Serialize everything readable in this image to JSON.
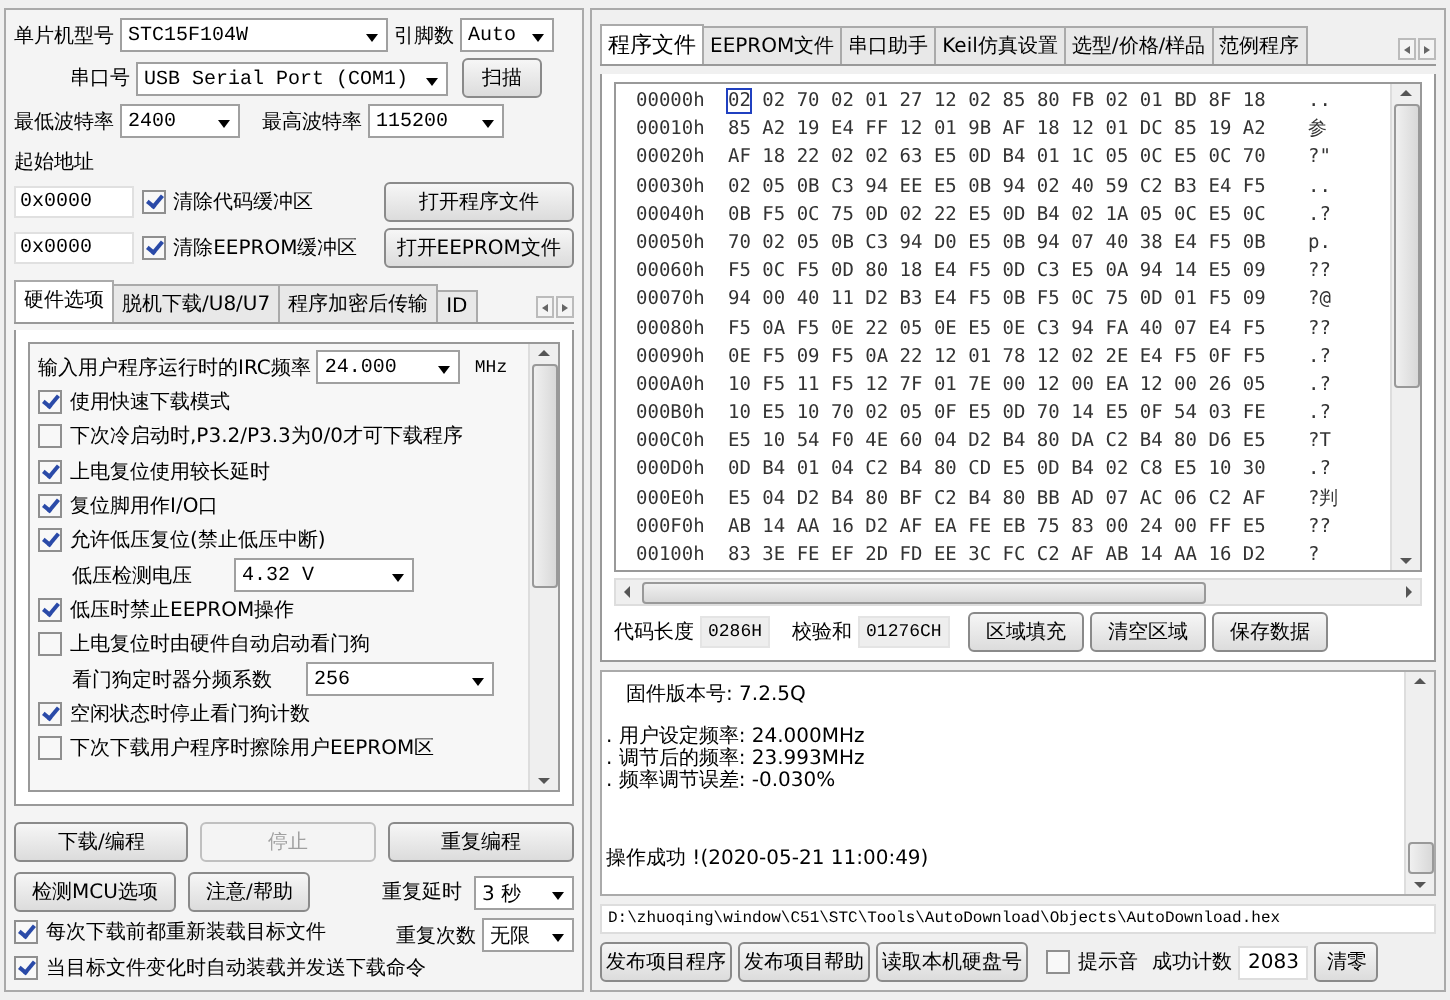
{
  "chip": {
    "label": "单片机型号",
    "value": "STC15F104W"
  },
  "pins": {
    "label": "引脚数",
    "value": "Auto"
  },
  "port": {
    "label": "串口号",
    "value": "USB Serial Port (COM1)",
    "button": "扫描"
  },
  "min_baud": {
    "label": "最低波特率",
    "value": "2400"
  },
  "max_baud": {
    "label": "最高波特率",
    "value": "115200"
  },
  "start_address": {
    "label": "起始地址",
    "rows": [
      {
        "value": "0x0000",
        "checkbox": "清除代码缓冲区",
        "checked": true,
        "button": "打开程序文件"
      },
      {
        "value": "0x0000",
        "checkbox": "清除EEPROM缓冲区",
        "checked": true,
        "button": "打开EEPROM文件"
      }
    ]
  },
  "left_tabs": [
    {
      "label": "硬件选项",
      "selected": true
    },
    {
      "label": "脱机下载/U8/U7",
      "selected": false
    },
    {
      "label": "程序加密后传输",
      "selected": false
    },
    {
      "label": "ID",
      "selected": false
    }
  ],
  "options": [
    {
      "kind": "freq",
      "label": "输入用户程序运行时的IRC频率",
      "value": "24.000",
      "unit": "MHz"
    },
    {
      "kind": "check",
      "label": "使用快速下载模式",
      "checked": true
    },
    {
      "kind": "check",
      "label": "下次冷启动时,P3.2/P3.3为0/0才可下载程序",
      "checked": false
    },
    {
      "kind": "check",
      "label": "上电复位使用较长延时",
      "checked": true
    },
    {
      "kind": "check",
      "label": "复位脚用作I/O口",
      "checked": true
    },
    {
      "kind": "check",
      "label": "允许低压复位(禁止低压中断)",
      "checked": true
    },
    {
      "kind": "combo",
      "label": "低压检测电压",
      "value": "4.32 V"
    },
    {
      "kind": "check",
      "label": "低压时禁止EEPROM操作",
      "checked": true
    },
    {
      "kind": "check",
      "label": "上电复位时由硬件自动启动看门狗",
      "checked": false
    },
    {
      "kind": "combo",
      "label": "看门狗定时器分频系数",
      "value": "256"
    },
    {
      "kind": "check",
      "label": "空闲状态时停止看门狗计数",
      "checked": true
    },
    {
      "kind": "check",
      "label": "下次下载用户程序时擦除用户EEPROM区",
      "checked": false
    }
  ],
  "actions": [
    {
      "label": "下载/编程",
      "disabled": false
    },
    {
      "label": "停止",
      "disabled": true
    },
    {
      "label": "重复编程",
      "disabled": false
    }
  ],
  "actions2": [
    {
      "label": "检测MCU选项",
      "disabled": false
    },
    {
      "label": "注意/帮助",
      "disabled": false
    }
  ],
  "repeat_delay": {
    "label": "重复延时",
    "value": "3 秒"
  },
  "repeat_count": {
    "label": "重复次数",
    "value": "无限"
  },
  "auto_checks": [
    {
      "label": "每次下载前都重新装载目标文件",
      "checked": true
    },
    {
      "label": "当目标文件变化时自动装载并发送下载命令",
      "checked": true
    }
  ],
  "right_tabs": [
    {
      "label": "程序文件",
      "selected": true
    },
    {
      "label": "EEPROM文件",
      "selected": false
    },
    {
      "label": "串口助手",
      "selected": false
    },
    {
      "label": "Keil仿真设置",
      "selected": false
    },
    {
      "label": "选型/价格/样品",
      "selected": false
    },
    {
      "label": "范例程序",
      "selected": false
    }
  ],
  "hex_rows": [
    {
      "address": "00000h",
      "bytes": "02 02 70 02 01 27 12 02 85 80 FB 02 01 BD 8F 18",
      "ascii": "..",
      "cursor": true
    },
    {
      "address": "00010h",
      "bytes": "85 A2 19 E4 FF 12 01 9B AF 18 12 01 DC 85 19 A2",
      "ascii": "参",
      "cursor": false
    },
    {
      "address": "00020h",
      "bytes": "AF 18 22 02 02 63 E5 0D B4 01 1C 05 0C E5 0C 70",
      "ascii": "?\"",
      "cursor": false
    },
    {
      "address": "00030h",
      "bytes": "02 05 0B C3 94 EE E5 0B 94 02 40 59 C2 B3 E4 F5",
      "ascii": "..",
      "cursor": false
    },
    {
      "address": "00040h",
      "bytes": "0B F5 0C 75 0D 02 22 E5 0D B4 02 1A 05 0C E5 0C",
      "ascii": ".?",
      "cursor": false
    },
    {
      "address": "00050h",
      "bytes": "70 02 05 0B C3 94 D0 E5 0B 94 07 40 38 E4 F5 0B",
      "ascii": "p.",
      "cursor": false
    },
    {
      "address": "00060h",
      "bytes": "F5 0C F5 0D 80 18 E4 F5 0D C3 E5 0A 94 14 E5 09",
      "ascii": "??",
      "cursor": false
    },
    {
      "address": "00070h",
      "bytes": "94 00 40 11 D2 B3 E4 F5 0B F5 0C 75 0D 01 F5 09",
      "ascii": "?@",
      "cursor": false
    },
    {
      "address": "00080h",
      "bytes": "F5 0A F5 0E 22 05 0E E5 0E C3 94 FA 40 07 E4 F5",
      "ascii": "??",
      "cursor": false
    },
    {
      "address": "00090h",
      "bytes": "0E F5 09 F5 0A 22 12 01 78 12 02 2E E4 F5 0F F5",
      "ascii": ".?",
      "cursor": false
    },
    {
      "address": "000A0h",
      "bytes": "10 F5 11 F5 12 7F 01 7E 00 12 00 EA 12 00 26 05",
      "ascii": ".?",
      "cursor": false
    },
    {
      "address": "000B0h",
      "bytes": "10 E5 10 70 02 05 0F E5 0D 70 14 E5 0F 54 03 FE",
      "ascii": ".?",
      "cursor": false
    },
    {
      "address": "000C0h",
      "bytes": "E5 10 54 F0 4E 60 04 D2 B4 80 DA C2 B4 80 D6 E5",
      "ascii": "?T",
      "cursor": false
    },
    {
      "address": "000D0h",
      "bytes": "0D B4 01 04 C2 B4 80 CD E5 0D B4 02 C8 E5 10 30",
      "ascii": ".?",
      "cursor": false
    },
    {
      "address": "000E0h",
      "bytes": "E5 04 D2 B4 80 BF C2 B4 80 BB AD 07 AC 06 C2 AF",
      "ascii": "?判",
      "cursor": false
    },
    {
      "address": "000F0h",
      "bytes": "AB 14 AA 16 D2 AF EA FE EB 75 83 00 24 00 FF E5",
      "ascii": "??",
      "cursor": false
    },
    {
      "address": "00100h",
      "bytes": "83 3E FE EF 2D FD EE 3C FC C2 AF AB 14 AA 16 D2",
      "ascii": "?",
      "cursor": false
    }
  ],
  "code_length": {
    "label": "代码长度",
    "value": "0286H"
  },
  "checksum": {
    "label": "校验和",
    "value": "01276CH"
  },
  "hex_buttons": [
    "区域填充",
    "清空区域",
    "保存数据"
  ],
  "log": [
    {
      "kind": "heading",
      "text": "固件版本号: 7.2.5Q"
    },
    {
      "kind": "detail",
      "text": ". 用户设定频率: 24.000MHz"
    },
    {
      "kind": "detail",
      "text": ". 调节后的频率: 23.993MHz"
    },
    {
      "kind": "detail",
      "text": ". 频率调节误差: -0.030%"
    },
    {
      "kind": "result",
      "text": "操作成功 !(2020-05-21 11:00:49)"
    }
  ],
  "file_path": "D:\\zhuoqing\\window\\C51\\STC\\Tools\\AutoDownload\\Objects\\AutoDownload.hex",
  "bottom_buttons": [
    "发布项目程序",
    "发布项目帮助",
    "读取本机硬盘号"
  ],
  "beep": {
    "label": "提示音",
    "checked": false
  },
  "success_count": {
    "label": "成功计数",
    "value": "2083",
    "button": "清零"
  }
}
